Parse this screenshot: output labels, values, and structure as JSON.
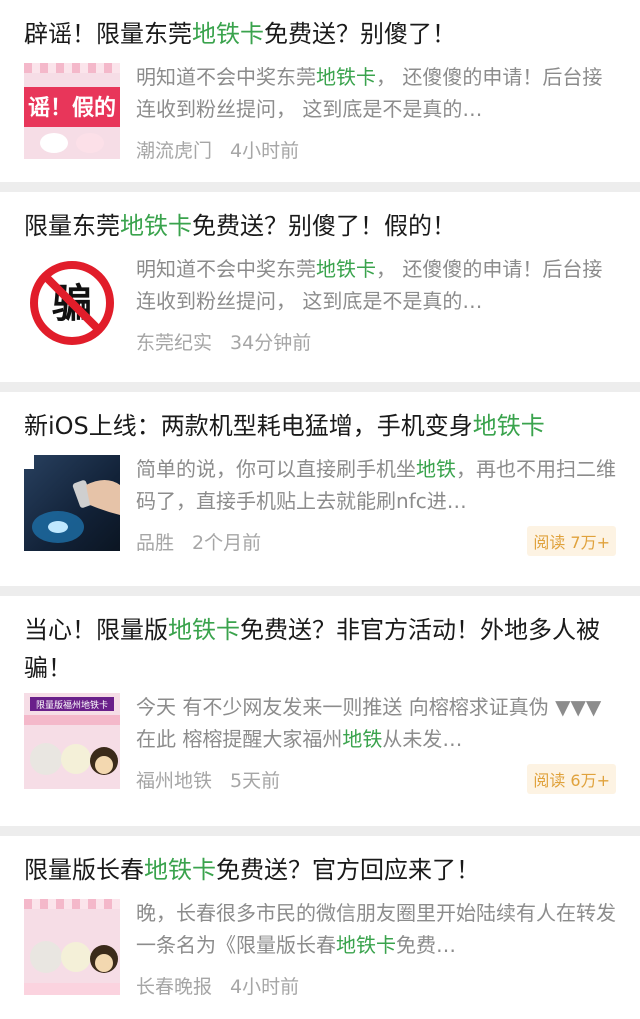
{
  "colors": {
    "highlight": "#3aa34d",
    "meta": "#a6a6a6",
    "badge_bg": "#fdf3e3",
    "badge_text": "#e0a23c"
  },
  "articles": [
    {
      "title_parts": [
        "辟谣！限量东莞",
        "地铁卡",
        "免费送？别傻了！"
      ],
      "snippet_parts": [
        "明知道不会中奖东莞",
        "地铁卡",
        "， 还傻傻的申请！后台接连收到粉丝提问， 这到底是不是真的…"
      ],
      "source": "潮流虎门",
      "time": "4小时前",
      "thumb_text": "谣！假的",
      "badge": ""
    },
    {
      "title_parts": [
        "限量东莞",
        "地铁卡",
        "免费送？别傻了！假的！"
      ],
      "snippet_parts": [
        "明知道不会中奖东莞",
        "地铁卡",
        "， 还傻傻的申请！后台接连收到粉丝提问， 这到底是不是真的…"
      ],
      "source": "东莞纪实",
      "time": "34分钟前",
      "thumb_text": "骗",
      "badge": ""
    },
    {
      "title_parts": [
        "新iOS上线：两款机型耗电猛增，手机变身",
        "地铁卡",
        ""
      ],
      "snippet_parts": [
        "简单的说，你可以直接刷手机坐",
        "地铁",
        "，再也不用扫二维码了，直接手机贴上去就能刷nfc进…"
      ],
      "source": "品胜",
      "time": "2个月前",
      "thumb_text": "",
      "badge": "阅读 7万+"
    },
    {
      "title_parts": [
        "当心！限量版",
        "地铁卡",
        "免费送？非官方活动！外地多人被骗！"
      ],
      "snippet_parts": [
        "今天 有不少网友发来一则推送 向榕榕求证真伪 ▼▼▼ 在此 榕榕提醒大家福州",
        "地铁",
        "从未发…"
      ],
      "source": "福州地铁",
      "time": "5天前",
      "thumb_text": "限量版福州地铁卡",
      "badge": "阅读 6万+"
    },
    {
      "title_parts": [
        "限量版长春",
        "地铁卡",
        "免费送？官方回应来了！"
      ],
      "snippet_parts": [
        "晚，长春很多市民的微信朋友圈里开始陆续有人在转发一条名为《限量版长春",
        "地铁卡",
        "免费…"
      ],
      "source": "长春晚报",
      "time": "4小时前",
      "thumb_text": "",
      "badge": ""
    }
  ]
}
